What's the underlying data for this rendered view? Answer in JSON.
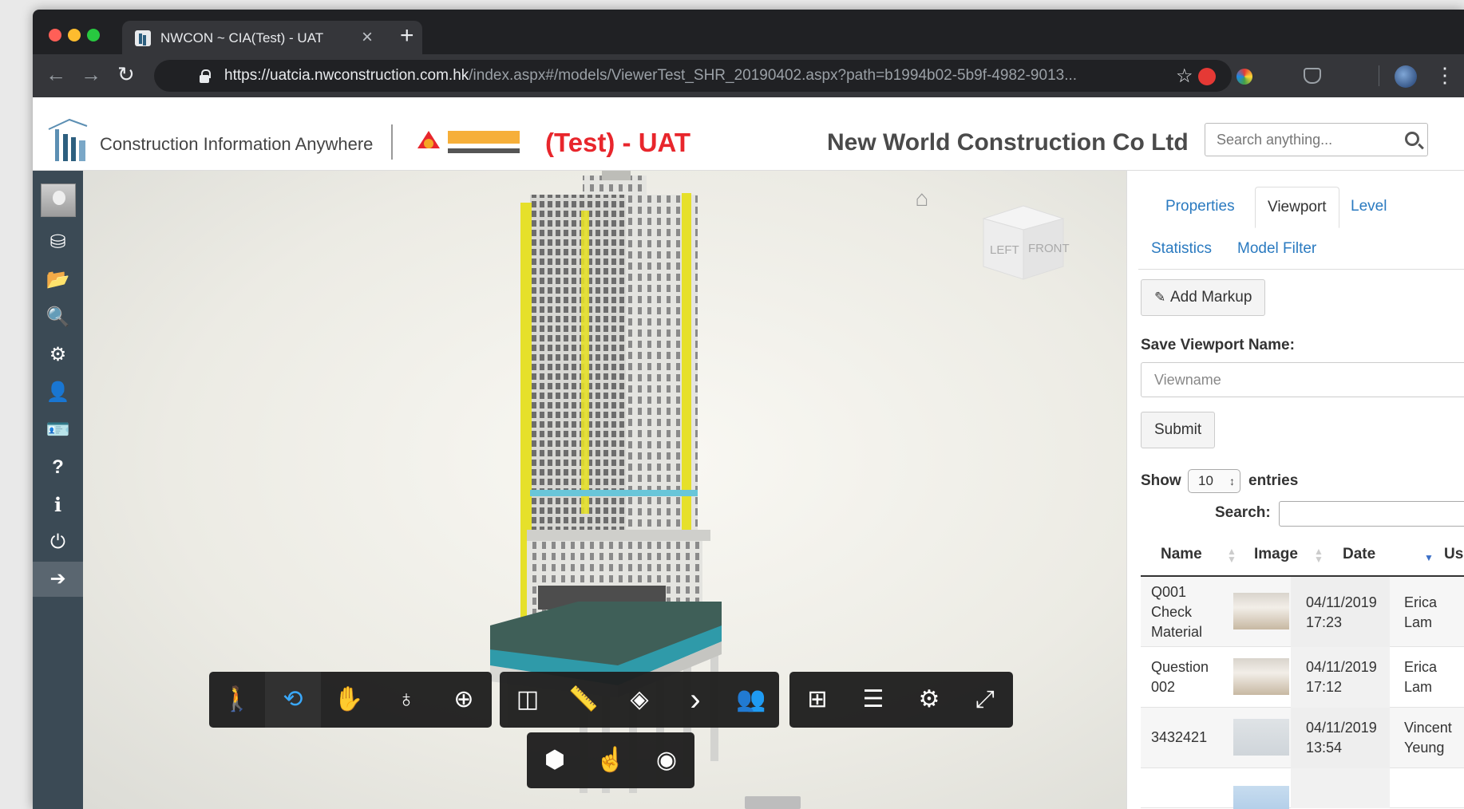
{
  "browser": {
    "tab_title": "NWCON ~ CIA(Test) - UAT",
    "close_glyph": "×",
    "new_tab_glyph": "+",
    "url_host": "https://uatcia.nwconstruction.com.hk",
    "url_path": "/index.aspx#/models/ViewerTest_SHR_20190402.aspx?path=b1994b02-5b9f-4982-9013...",
    "back_glyph": "←",
    "forward_glyph": "→",
    "reload_glyph": "↻",
    "star_glyph": "☆",
    "menu_glyph": "⋮"
  },
  "header": {
    "logo_text": "Construction Information Anywhere",
    "env_label": "(Test) - UAT",
    "company": "New World Construction Co Ltd",
    "search_placeholder": "Search anything..."
  },
  "sidebar": {
    "items": [
      {
        "icon": "cubes-icon",
        "glyph": "⛁"
      },
      {
        "icon": "folder-open-icon",
        "glyph": "📂"
      },
      {
        "icon": "search-icon",
        "glyph": "🔍"
      },
      {
        "icon": "gears-icon",
        "glyph": "⚙"
      },
      {
        "icon": "user-icon",
        "glyph": "👤"
      },
      {
        "icon": "id-card-icon",
        "glyph": "🪪"
      },
      {
        "icon": "question-circle-icon",
        "glyph": "?"
      },
      {
        "icon": "info-icon",
        "glyph": "i"
      },
      {
        "icon": "power-icon",
        "glyph": "⏻"
      },
      {
        "icon": "arrow-circle-right-icon",
        "glyph": "➔"
      }
    ]
  },
  "viewcube": {
    "left": "LEFT",
    "front": "FRONT"
  },
  "viewer_toolbar": {
    "group1": [
      {
        "icon": "walk-icon",
        "glyph": "🚶"
      },
      {
        "icon": "orbit-icon",
        "glyph": "⟲"
      },
      {
        "icon": "pan-icon",
        "glyph": "✋"
      },
      {
        "icon": "camera-interaction-icon",
        "glyph": "♁"
      },
      {
        "icon": "fit-to-view-icon",
        "glyph": "⊕"
      }
    ],
    "group2": [
      {
        "icon": "section-analysis-icon",
        "glyph": "◫"
      },
      {
        "icon": "measure-icon",
        "glyph": "📏"
      },
      {
        "icon": "explode-icon",
        "glyph": "◈"
      },
      {
        "icon": "chevron-right-icon",
        "glyph": "›"
      },
      {
        "icon": "people-icon",
        "glyph": "👥"
      }
    ],
    "group3": [
      {
        "icon": "model-browser-icon",
        "glyph": "⊞"
      },
      {
        "icon": "properties-icon",
        "glyph": "☰"
      },
      {
        "icon": "settings-icon",
        "glyph": "⚙"
      },
      {
        "icon": "fullscreen-icon",
        "glyph": "⤢"
      }
    ],
    "group4": [
      {
        "icon": "cube-icon",
        "glyph": "⬢"
      },
      {
        "icon": "hand-select-icon",
        "glyph": "☝"
      },
      {
        "icon": "eye-icon",
        "glyph": "◉"
      }
    ]
  },
  "panel": {
    "tabs": [
      "Properties",
      "Viewport",
      "Level",
      "Statistics",
      "Model Filter"
    ],
    "add_markup": "Add Markup",
    "save_label": "Save Viewport Name:",
    "viewname_placeholder": "Viewname",
    "submit": "Submit",
    "show_label": "Show",
    "show_value": "10",
    "entries_label": "entries",
    "search_label": "Search:",
    "columns": [
      "Name",
      "Image",
      "Date",
      "User"
    ],
    "rows": [
      {
        "name_lines": [
          "Q001",
          "Check",
          "Material"
        ],
        "date_lines": [
          "04/11/2019",
          "17:23"
        ],
        "user_lines": [
          "Erica",
          "Lam"
        ]
      },
      {
        "name_lines": [
          "Question",
          "002"
        ],
        "date_lines": [
          "04/11/2019",
          "17:12"
        ],
        "user_lines": [
          "Erica",
          "Lam"
        ]
      },
      {
        "name_lines": [
          "3432421"
        ],
        "date_lines": [
          "04/11/2019",
          "13:54"
        ],
        "user_lines": [
          "Vincent",
          "Yeung"
        ]
      }
    ]
  }
}
